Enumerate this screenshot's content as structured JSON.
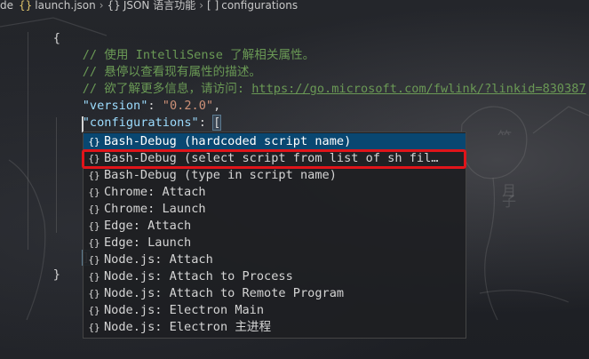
{
  "breadcrumb": {
    "prefix": "de",
    "file_icon": "{}",
    "file": "launch.json",
    "sep1": "›",
    "section_icon": "{}",
    "section": "JSON 语言功能",
    "sep2": "›",
    "array_icon": "[ ]",
    "node": "configurations"
  },
  "editor": {
    "open_brace": "{",
    "comment1": "// 使用 IntelliSense 了解相关属性。",
    "comment2": "// 悬停以查看现有属性的描述。",
    "comment3_prefix": "// 欲了解更多信息，请访问: ",
    "comment3_link": "https://go.microsoft.com/fwlink/?linkid=830387",
    "version_key": "\"version\"",
    "version_colon": ": ",
    "version_value": "\"0.2.0\"",
    "version_comma": ",",
    "configurations_key": "\"configurations\"",
    "configurations_colon": ": ",
    "open_bracket": "[",
    "close_bracket": "]",
    "close_brace": "}"
  },
  "suggest": {
    "icon": "{}",
    "items": [
      "Bash-Debug (hardcoded script name)",
      "Bash-Debug (select script from list of sh fil…",
      "Bash-Debug (type in script name)",
      "Chrome: Attach",
      "Chrome: Launch",
      "Edge: Attach",
      "Edge: Launch",
      "Node.js: Attach",
      "Node.js: Attach to Process",
      "Node.js: Attach to Remote Program",
      "Node.js: Electron Main",
      "Node.js: Electron 主进程"
    ],
    "selected_index": 0,
    "highlighted_index": 1
  },
  "colors": {
    "selected_background": "#094771",
    "highlight_border": "#e0141a",
    "comment": "#6a9955",
    "key": "#9cdcfe",
    "string": "#ce9178"
  }
}
